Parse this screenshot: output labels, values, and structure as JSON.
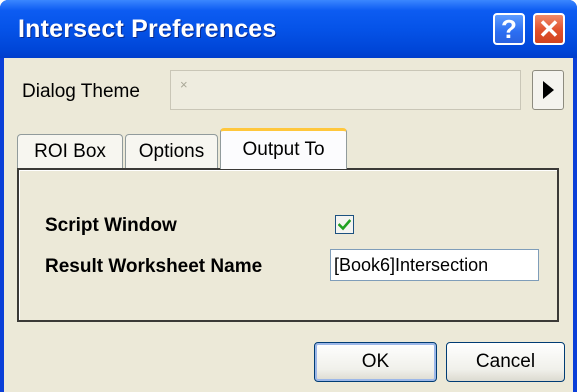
{
  "window": {
    "title": "Intersect Preferences",
    "help_label": "?",
    "close_label": "✕"
  },
  "theme": {
    "label": "Dialog Theme",
    "value": "×"
  },
  "tabs": [
    {
      "label": "ROI Box"
    },
    {
      "label": "Options"
    },
    {
      "label": "Output To",
      "selected": true
    }
  ],
  "output": {
    "script_window_label": "Script Window",
    "script_window_checked": true,
    "result_label": "Result Worksheet Name",
    "result_value": "[Book6]Intersection"
  },
  "buttons": {
    "ok": "OK",
    "cancel": "Cancel"
  },
  "colors": {
    "titlebar": "#0553e8",
    "checkmark": "#21a121",
    "tab_highlight": "#ffc73c"
  }
}
